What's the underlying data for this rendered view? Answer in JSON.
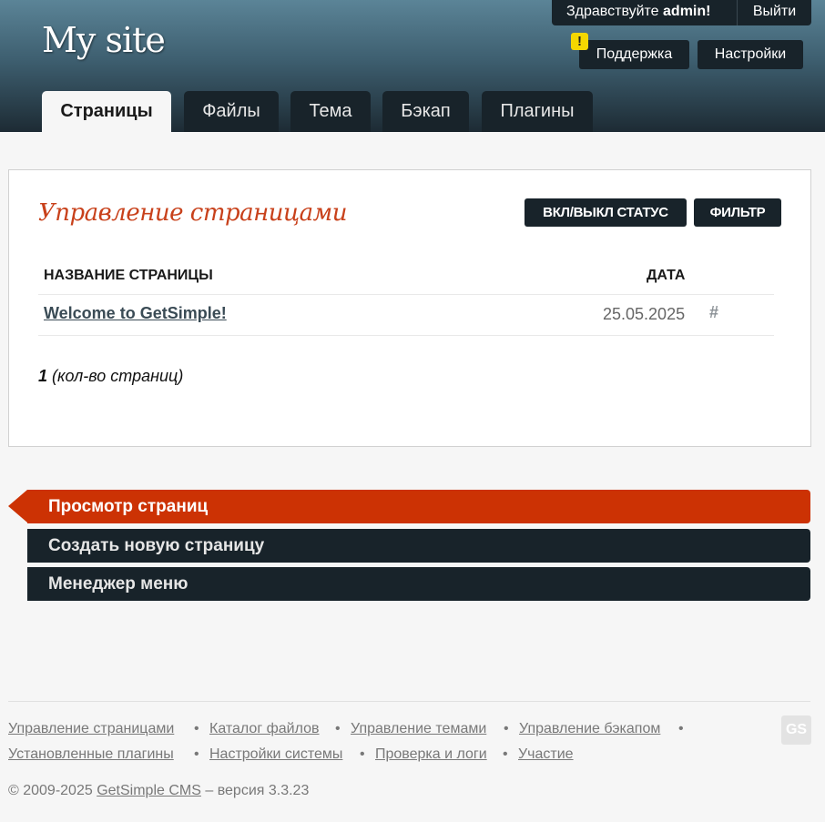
{
  "header": {
    "site_title": "My site",
    "greeting_prefix": "Здравствуйте",
    "username": "admin!",
    "logout": "Выйти",
    "support": "Поддержка",
    "settings": "Настройки",
    "warning_badge": "!"
  },
  "tabs": [
    {
      "label": "Страницы",
      "active": true
    },
    {
      "label": "Файлы"
    },
    {
      "label": "Тема"
    },
    {
      "label": "Бэкап"
    },
    {
      "label": "Плагины"
    }
  ],
  "main": {
    "title": "Управление страницами",
    "toggle_status": "ВКЛ/ВЫКЛ СТАТУС",
    "filter": "ФИЛЬТР",
    "columns": [
      "НАЗВАНИЕ СТРАНИЦЫ",
      "ДАТА"
    ],
    "rows": [
      {
        "title": "Welcome to GetSimple!",
        "date": "25.05.2025",
        "link": "#"
      }
    ],
    "count": "1",
    "count_label": "(кол-во страниц)"
  },
  "sidemenu": [
    {
      "label": "Просмотр страниц",
      "current": true
    },
    {
      "label": "Создать новую страницу"
    },
    {
      "label": "Менеджер меню"
    }
  ],
  "footer": {
    "links": [
      "Управление страницами",
      "Каталог файлов",
      "Управление темами",
      "Управление бэкапом",
      "Установленные плагины",
      "Настройки системы",
      "Проверка и логи",
      "Участие"
    ],
    "separator": "•",
    "copyright_prefix": "© 2009-2025",
    "cms_name": "GetSimple CMS",
    "version_text": "– версия 3.3.23",
    "logo_text": "GS"
  },
  "colors": {
    "accent": "#cc3204",
    "dark": "#18232a",
    "title_red": "#c8411b"
  }
}
